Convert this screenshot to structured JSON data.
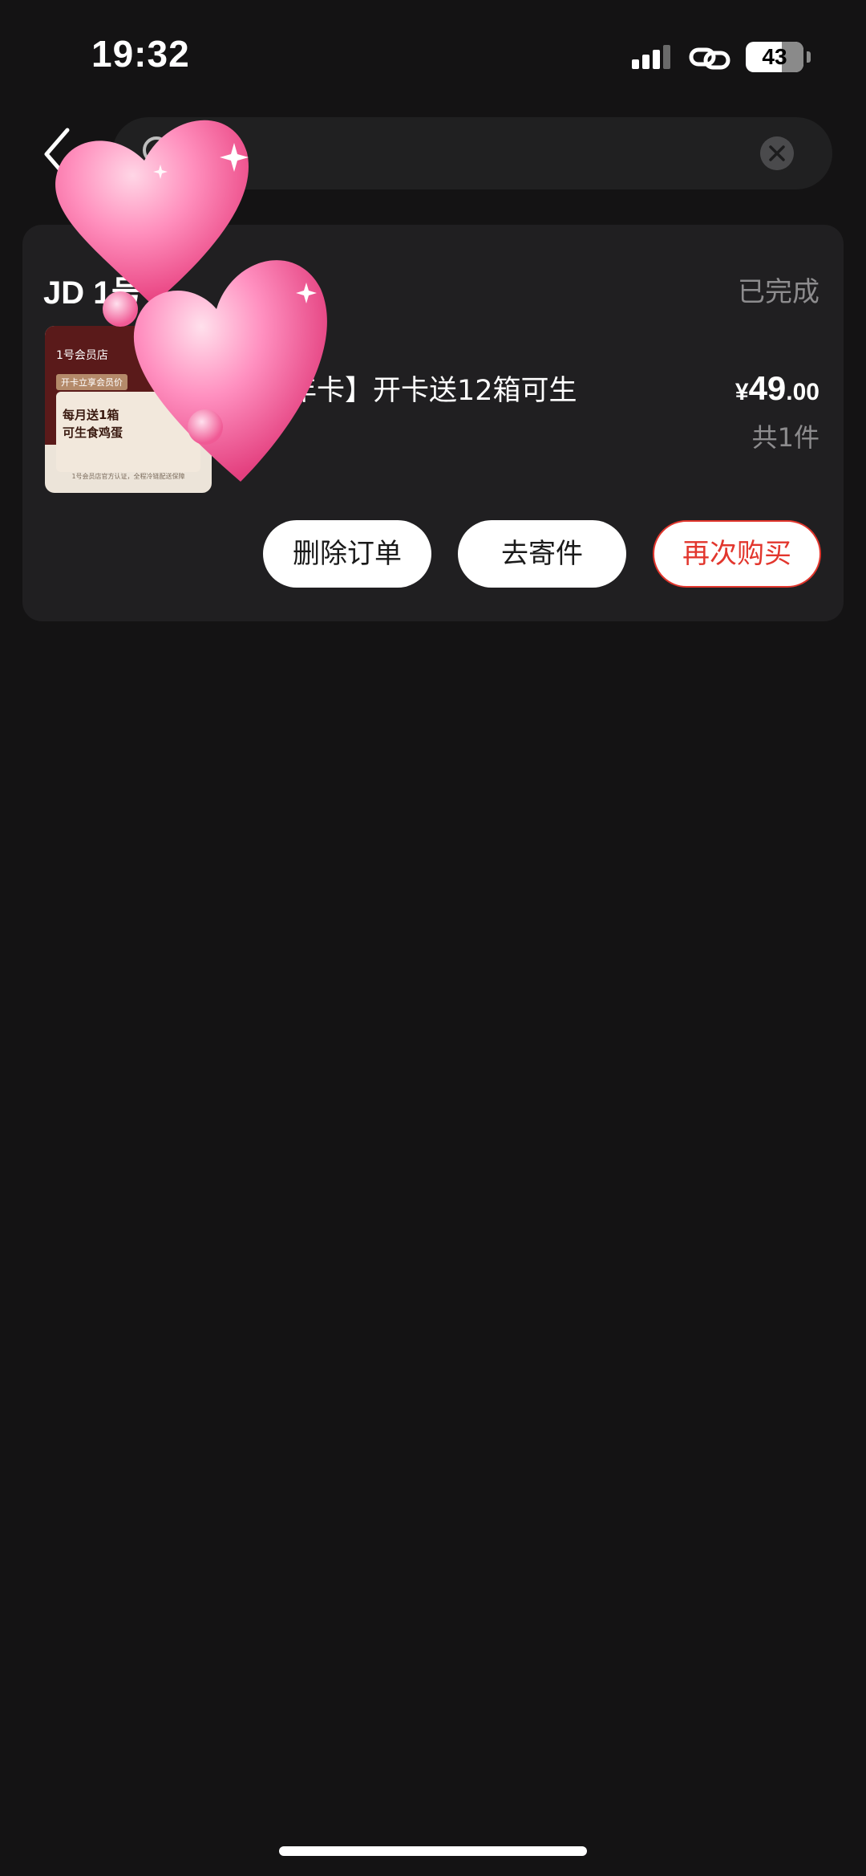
{
  "status_bar": {
    "time": "19:32",
    "battery": "43"
  },
  "search": {
    "placeholder": ""
  },
  "order": {
    "shop_name": "JD 1号",
    "status": "已完成",
    "product_title": "员店年卡】开卡送12箱可生",
    "product_spec": "",
    "price_currency": "¥",
    "price_integer": "49",
    "price_decimal": ".00",
    "quantity": "共1件",
    "image_texts": {
      "logo": "1号会员店",
      "tag": "开卡立享会员价",
      "line1": "每月送1箱",
      "line2": "可生食鸡蛋",
      "note": "1号会员店官方认证，全程冷链配送保障"
    }
  },
  "actions": {
    "delete": "删除订单",
    "send": "去寄件",
    "rebuy": "再次购买"
  },
  "icons": [
    "back-icon",
    "search-icon",
    "clear-icon",
    "signal-icon",
    "link-icon",
    "battery-icon",
    "hearts-sticker"
  ],
  "colors": {
    "background": "#141314",
    "card": "#201f21",
    "accent": "#e2362d",
    "heart": "#ff7fb0"
  }
}
